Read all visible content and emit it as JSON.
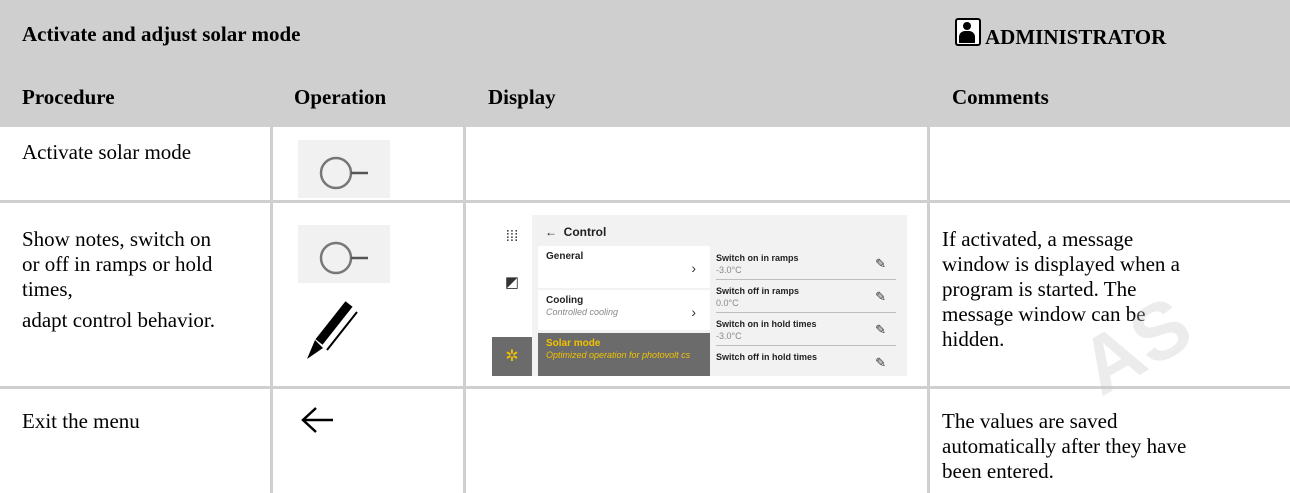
{
  "header": {
    "title": "Activate and adjust solar mode",
    "role": "ADMINISTRATOR"
  },
  "columns": [
    "Procedure",
    "Operation",
    "Display",
    "Comments"
  ],
  "rows": [
    {
      "procedure": "Activate solar mode",
      "comment": ""
    },
    {
      "procedure_lines": [
        "Show notes, switch on",
        "or off in ramps or hold",
        "times,",
        "adapt control behavior."
      ],
      "comment_lines": [
        "If activated, a message",
        "window is displayed when a",
        "program is started. The",
        "message window can be",
        "hidden."
      ]
    },
    {
      "procedure": "Exit the menu",
      "comment_lines": [
        "The values are saved",
        "automatically after they have",
        "been entered."
      ]
    }
  ],
  "display": {
    "header": "Control",
    "menu": [
      {
        "title": "General",
        "subtitle": ""
      },
      {
        "title": "Cooling",
        "subtitle": "Controlled cooling"
      },
      {
        "title": "Solar mode",
        "subtitle": "Optimized operation for photovolt cs"
      }
    ],
    "settings": [
      {
        "label": "Switch on in ramps",
        "value": "-3.0°C"
      },
      {
        "label": "Switch off in ramps",
        "value": "0.0°C"
      },
      {
        "label": "Switch on in hold times",
        "value": "-3.0°C"
      },
      {
        "label": "Switch off in hold times",
        "value": ""
      }
    ]
  },
  "icons": {
    "admin": "person-icon",
    "knob": "knob-icon",
    "edit": "pencil-icon",
    "back": "back-arrow-icon",
    "grid": "grid-icon",
    "chart": "chart-icon",
    "gear": "gear-icon"
  },
  "colors": {
    "header_bg": "#cfcfcf",
    "display_accent": "#f2c200",
    "active_bg": "#6b6b6b"
  },
  "watermark": "AS"
}
